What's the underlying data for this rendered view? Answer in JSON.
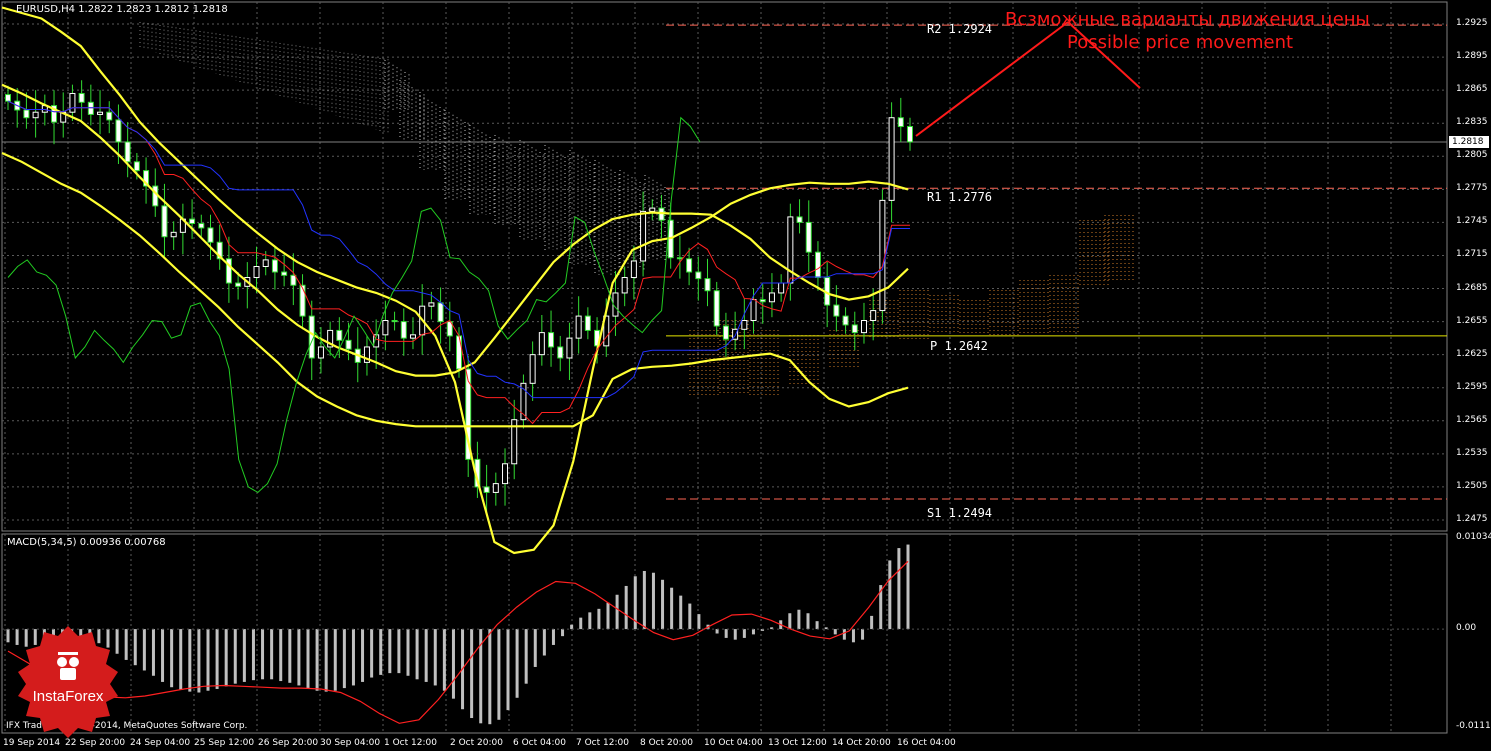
{
  "header": {
    "symbol_line": "EURUSD,H4  1.2822 1.2823 1.2812 1.2818",
    "macd_line": "MACD(5,34,5) 0.00936 0.00768"
  },
  "annotation": {
    "ru": "Всзможные варианты движения цены",
    "en": "Possible price movement"
  },
  "pivots": {
    "r2": "R2  1.2924",
    "r1": "R1  1.2776",
    "p": "P  1.2642",
    "s1": "S1  1.2494"
  },
  "current_price": "1.2818",
  "copyright": "IFX Trader, © 2001-2014, MetaQuotes Software Corp.",
  "logo_text": "InstaForex",
  "colors": {
    "bull": "#ffffff",
    "bear": "#ffffff",
    "bollinger": "#ffff33",
    "tenkan": "#ff2020",
    "kijun": "#2233ff",
    "chikou": "#22cc22",
    "cloud_up": "#ffffff",
    "cloud_down": "#ff9933",
    "pivot": "#ff6655",
    "pivot_p": "#e6e600",
    "macd_hist": "#c0c0c0",
    "macd_signal": "#ff2020",
    "arrow": "#ff1a1a"
  },
  "chart_data": [
    {
      "type": "candlestick",
      "title": "EURUSD,H4",
      "y_ticks": [
        "1.2925",
        "1.2895",
        "1.2865",
        "1.2835",
        "1.2805",
        "1.2775",
        "1.2745",
        "1.2715",
        "1.2685",
        "1.2655",
        "1.2625",
        "1.2595",
        "1.2565",
        "1.2535",
        "1.2505",
        "1.2475"
      ],
      "x_ticks": [
        "19 Sep 2014",
        "22 Sep 20:00",
        "24 Sep 04:00",
        "25 Sep 12:00",
        "26 Sep 20:00",
        "30 Sep 04:00",
        "1 Oct 12:00",
        "2 Oct 20:00",
        "6 Oct 04:00",
        "7 Oct 12:00",
        "8 Oct 20:00",
        "10 Oct 04:00",
        "13 Oct 12:00",
        "14 Oct 20:00",
        "16 Oct 04:00"
      ],
      "ylim": [
        1.2465,
        1.2945
      ],
      "series": [
        {
          "name": "price_close",
          "values": [
            1.2855,
            1.2847,
            1.284,
            1.2845,
            1.2851,
            1.2836,
            1.2845,
            1.2862,
            1.2854,
            1.2843,
            1.2845,
            1.2838,
            1.2818,
            1.28,
            1.2792,
            1.2778,
            1.276,
            1.2732,
            1.2736,
            1.2748,
            1.2744,
            1.274,
            1.2727,
            1.2712,
            1.269,
            1.2687,
            1.2695,
            1.2705,
            1.2711,
            1.27,
            1.2697,
            1.2688,
            1.266,
            1.2622,
            1.2632,
            1.2647,
            1.2638,
            1.263,
            1.2618,
            1.2632,
            1.2643,
            1.2656,
            1.2655,
            1.264,
            1.2643,
            1.2669,
            1.2672,
            1.2655,
            1.2642,
            1.2612,
            1.253,
            1.2505,
            1.25,
            1.2508,
            1.2526,
            1.2566,
            1.2599,
            1.2625,
            1.2645,
            1.2632,
            1.2622,
            1.264,
            1.266,
            1.2647,
            1.2633,
            1.266,
            1.2681,
            1.2695,
            1.271,
            1.2755,
            1.2758,
            1.2747,
            1.2713,
            1.2712,
            1.27,
            1.2694,
            1.2683,
            1.2651,
            1.2639,
            1.2648,
            1.2656,
            1.2675,
            1.2673,
            1.2681,
            1.269,
            1.275,
            1.2745,
            1.2718,
            1.2695,
            1.267,
            1.266,
            1.2652,
            1.2645,
            1.2656,
            1.2665,
            1.2765,
            1.284,
            1.2832,
            1.2818
          ]
        },
        {
          "name": "bollinger_mid",
          "values": [
            1.287,
            1.2862,
            1.2853,
            1.2845,
            1.2837,
            1.2822,
            1.2805,
            1.2786,
            1.2768,
            1.2751,
            1.2733,
            1.2715,
            1.2698,
            1.2683,
            1.2666,
            1.2652,
            1.2641,
            1.2632,
            1.2625,
            1.2618,
            1.261,
            1.2606,
            1.2606,
            1.2609,
            1.2618,
            1.264,
            1.2663,
            1.2686,
            1.2709,
            1.2725,
            1.2738,
            1.2748,
            1.2752,
            1.2754,
            1.2753,
            1.2753,
            1.2752,
            1.2742,
            1.273,
            1.2713,
            1.2701,
            1.269,
            1.268,
            1.2675,
            1.2678,
            1.2686,
            1.2703
          ]
        },
        {
          "name": "bollinger_upper",
          "values": [
            1.294,
            1.2935,
            1.293,
            1.2918,
            1.2905,
            1.2882,
            1.286,
            1.2836,
            1.2817,
            1.28,
            1.2783,
            1.2766,
            1.275,
            1.2735,
            1.2721,
            1.2709,
            1.27,
            1.2693,
            1.2686,
            1.2681,
            1.2674,
            1.2664,
            1.2642,
            1.26,
            1.252,
            1.2455,
            1.2445,
            1.2448,
            1.247,
            1.2528,
            1.2612,
            1.269,
            1.272,
            1.2728,
            1.2731,
            1.274,
            1.275,
            1.2762,
            1.277,
            1.2776,
            1.2779,
            1.2781,
            1.278,
            1.278,
            1.2782,
            1.278,
            1.2775
          ]
        },
        {
          "name": "bollinger_lower",
          "values": [
            1.2808,
            1.28,
            1.279,
            1.278,
            1.2772,
            1.276,
            1.2747,
            1.2733,
            1.2717,
            1.27,
            1.2684,
            1.2668,
            1.265,
            1.2634,
            1.2618,
            1.26,
            1.2587,
            1.2578,
            1.257,
            1.2565,
            1.2562,
            1.256,
            1.256,
            1.256,
            1.256,
            1.256,
            1.256,
            1.256,
            1.256,
            1.256,
            1.257,
            1.2603,
            1.2612,
            1.2614,
            1.2615,
            1.2617,
            1.262,
            1.2622,
            1.2624,
            1.2626,
            1.262,
            1.26,
            1.2585,
            1.2578,
            1.2582,
            1.259,
            1.2595
          ]
        },
        {
          "name": "pivot_levels",
          "values": [
            1.2924,
            1.2776,
            1.2642,
            1.2494
          ]
        }
      ]
    },
    {
      "type": "bar",
      "title": "MACD(5,34,5)",
      "y_ticks": [
        "0.01034",
        "0.00",
        "-0.01117"
      ],
      "ylim": [
        -0.0118,
        0.0108
      ],
      "series": [
        {
          "name": "macd_histogram",
          "values": [
            -0.0015,
            -0.0018,
            -0.002,
            -0.0018,
            -0.0016,
            -0.0015,
            -0.0014,
            -0.0013,
            -0.0012,
            -0.0013,
            -0.0016,
            -0.0021,
            -0.0028,
            -0.0035,
            -0.0041,
            -0.0047,
            -0.0053,
            -0.006,
            -0.0066,
            -0.0069,
            -0.0071,
            -0.0072,
            -0.007,
            -0.0068,
            -0.0065,
            -0.0062,
            -0.006,
            -0.0058,
            -0.0057,
            -0.0057,
            -0.0059,
            -0.0061,
            -0.0064,
            -0.0068,
            -0.007,
            -0.0071,
            -0.007,
            -0.0067,
            -0.0064,
            -0.006,
            -0.0055,
            -0.0052,
            -0.005,
            -0.005,
            -0.0053,
            -0.0057,
            -0.006,
            -0.0064,
            -0.007,
            -0.0079,
            -0.0091,
            -0.0101,
            -0.0107,
            -0.0108,
            -0.0103,
            -0.0092,
            -0.0078,
            -0.0062,
            -0.0043,
            -0.003,
            -0.0018,
            -0.0008,
            0.0005,
            0.0013,
            0.0019,
            0.0023,
            0.003,
            0.0039,
            0.0049,
            0.006,
            0.0066,
            0.0064,
            0.0056,
            0.0047,
            0.0038,
            0.0029,
            0.0017,
            0.0005,
            -0.0005,
            -0.001,
            -0.0012,
            -0.001,
            -0.0006,
            -0.0002,
            0.0002,
            0.001,
            0.0018,
            0.0022,
            0.0018,
            0.0009,
            0.0002,
            -0.0006,
            -0.0012,
            -0.0015,
            -0.0012,
            0.0015,
            0.005,
            0.0078,
            0.0092,
            0.0096
          ]
        },
        {
          "name": "macd_signal",
          "values": [
            -0.0025,
            -0.0038,
            -0.0052,
            -0.0064,
            -0.0073,
            -0.0077,
            -0.0078,
            -0.0076,
            -0.0072,
            -0.0068,
            -0.0065,
            -0.0064,
            -0.0065,
            -0.0066,
            -0.0067,
            -0.0067,
            -0.0068,
            -0.0072,
            -0.0082,
            -0.0096,
            -0.0107,
            -0.0103,
            -0.008,
            -0.0052,
            -0.0022,
            0.0005,
            0.0025,
            0.0042,
            0.0054,
            0.0052,
            0.004,
            0.0025,
            0.001,
            -0.0004,
            -0.0012,
            -0.0007,
            0.0005,
            0.0016,
            0.0017,
            0.001,
            0.0,
            -0.0008,
            -0.0011,
            -0.0002,
            0.0025,
            0.0055,
            0.0077
          ]
        }
      ]
    }
  ]
}
